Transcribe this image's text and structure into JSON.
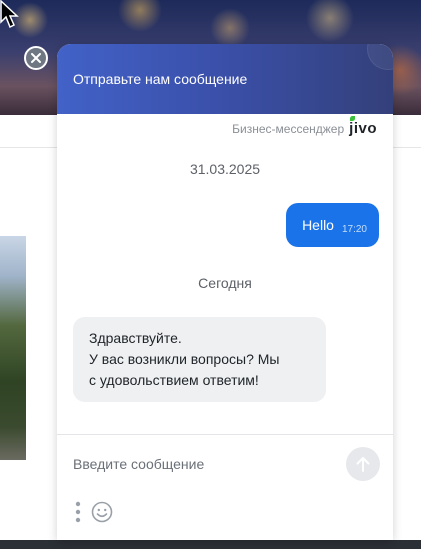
{
  "colors": {
    "header_gradient_start": "#4262c8",
    "header_gradient_end": "#34407a",
    "outgoing_bubble": "#1a73e8",
    "incoming_bubble": "#eef0f2",
    "brand_leaf": "#3cbf3c"
  },
  "header": {
    "title": "Отправьте нам сообщение",
    "close_icon": "close-icon"
  },
  "branding": {
    "label": "Бизнес-мессенджер",
    "logo_text": "jivo"
  },
  "messages": [
    {
      "type": "date",
      "text": "31.03.2025"
    },
    {
      "type": "outgoing",
      "text": "Hello",
      "time": "17:20"
    },
    {
      "type": "date",
      "text": "Сегодня"
    },
    {
      "type": "incoming",
      "lines": [
        "Здравствуйте.",
        "У вас возникли вопросы? Мы",
        "с удовольствием ответим!"
      ]
    }
  ],
  "composer": {
    "placeholder": "Введите сообщение",
    "value": "",
    "send_icon": "arrow-up-icon",
    "more_icon": "vertical-dots-icon",
    "emoji_icon": "smiley-icon"
  }
}
